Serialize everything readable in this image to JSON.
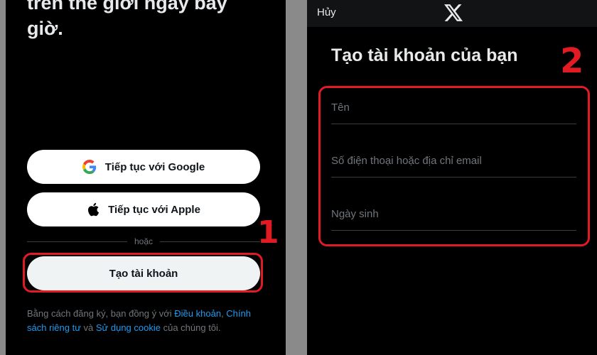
{
  "left_screen": {
    "headline": "trên thế giới ngay bây\ngiờ.",
    "google_label": "Tiếp tục với Google",
    "apple_label": "Tiếp tục với Apple",
    "divider_text": "hoặc",
    "create_account_label": "Tạo tài khoản",
    "terms": {
      "prefix": "Bằng cách đăng ký, bạn đồng ý với ",
      "terms_link": "Điều khoản",
      "comma": ", ",
      "privacy_link_1": "Chính",
      "privacy_link_2": "sách riêng tư",
      "and": " và ",
      "cookie_link": "Sử dụng cookie",
      "suffix": " của chúng tôi."
    },
    "step_label": "1"
  },
  "right_screen": {
    "cancel_label": "Hủy",
    "title": "Tạo tài khoản của bạn",
    "fields": {
      "name_placeholder": "Tên",
      "contact_placeholder": "Số điện thoại hoặc địa chỉ email",
      "birthdate_placeholder": "Ngày sinh"
    },
    "step_label": "2"
  },
  "icons": {
    "google": "google-logo-icon",
    "apple": "apple-logo-icon",
    "x": "x-logo-icon"
  },
  "colors": {
    "background": "#000000",
    "highlight": "#e01b24",
    "link": "#1d9bf0",
    "muted_text": "#71767b",
    "button_bg": "#ffffff"
  }
}
